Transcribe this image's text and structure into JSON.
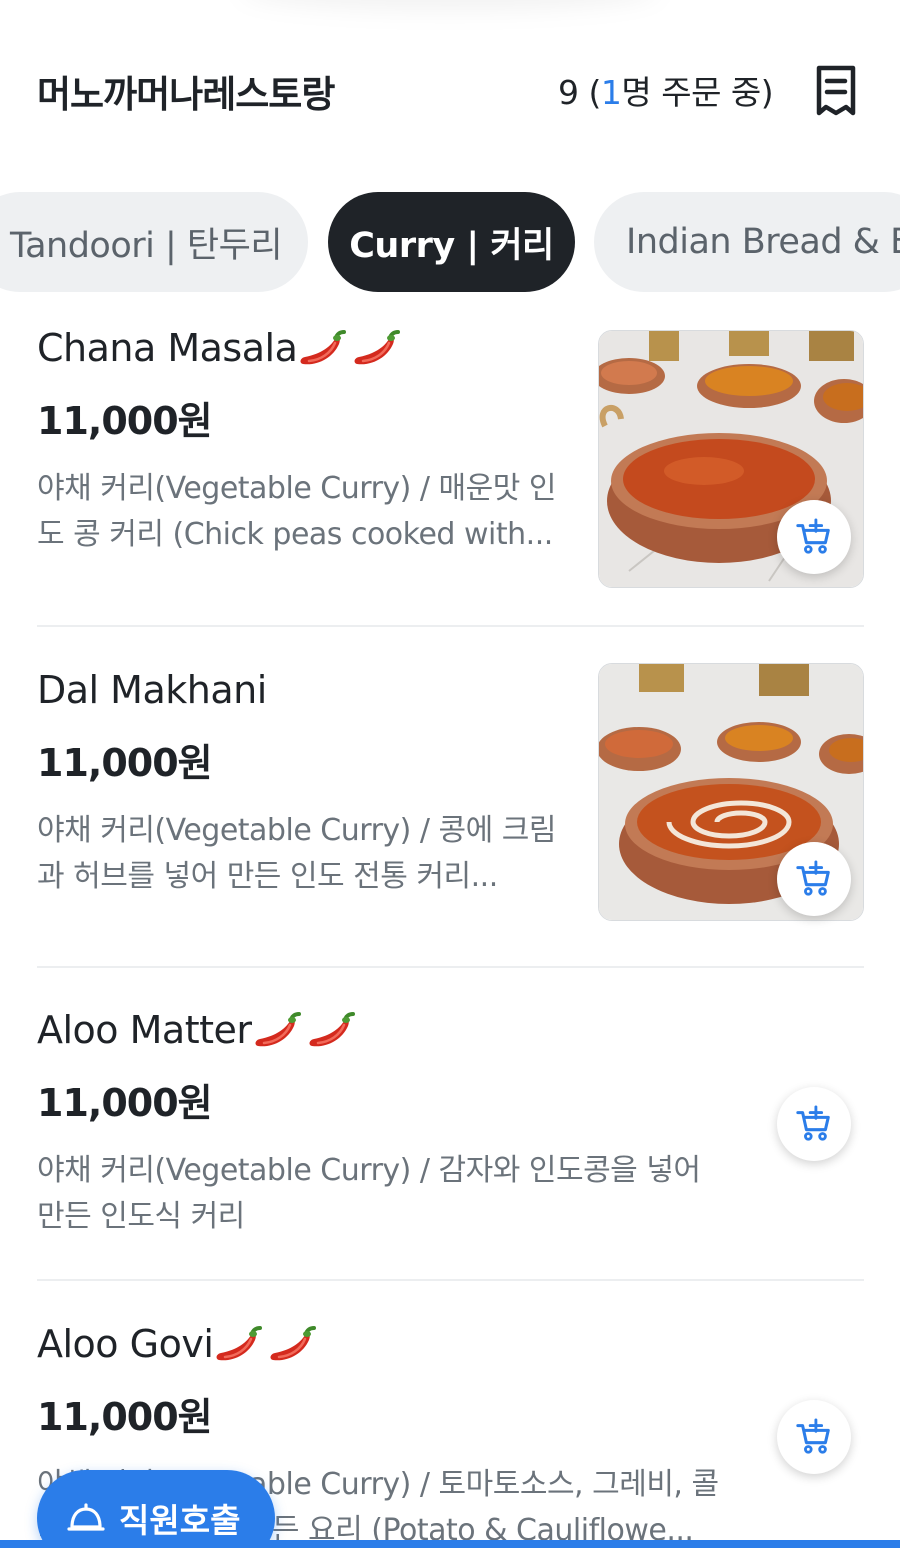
{
  "header": {
    "restaurant_name": "머노까머나레스토랑",
    "order_count": "9",
    "order_status_prefix": " (",
    "order_people": "1",
    "order_status_suffix": "명 주문 중)",
    "receipt_icon": "receipt-icon"
  },
  "tabs": [
    {
      "label": "Tandoori | 탄두리",
      "active": false
    },
    {
      "label": "Curry | 커리",
      "active": true
    },
    {
      "label": "Indian Bread & B",
      "active": false
    }
  ],
  "items": [
    {
      "name": "Chana Masala",
      "chili_count": 2,
      "price": "11,000원",
      "desc_line1": "야채 커리(Vegetable Curry) / 매운맛 인",
      "desc_line2": "도 콩 커리 (Chick peas cooked with...",
      "has_image": true
    },
    {
      "name": "Dal Makhani",
      "chili_count": 0,
      "price": "11,000원",
      "desc_line1": "야채 커리(Vegetable Curry) / 콩에 크림",
      "desc_line2": "과 허브를 넣어 만든 인도 전통 커리...",
      "has_image": true
    },
    {
      "name": "Aloo Matter",
      "chili_count": 2,
      "price": "11,000원",
      "desc_line1": "야채 커리(Vegetable Curry) / 감자와 인도콩을 넣어",
      "desc_line2": "만든 인도식 커리",
      "has_image": false
    },
    {
      "name": "Aloo Govi",
      "chili_count": 2,
      "price": "11,000원",
      "desc_line1": "야채 커리(Vegetable Curry) / 토마토소스, 그레비, 콜",
      "desc_line2": "리플라워를 넣어 만든 요리 (Potato & Cauliflowe...",
      "has_image": false
    }
  ],
  "staff_call": {
    "label": "직원호출",
    "icon": "bell-icon"
  },
  "colors": {
    "accent": "#2b7de9",
    "dark": "#1f2328",
    "chili": "#d42a1e"
  }
}
